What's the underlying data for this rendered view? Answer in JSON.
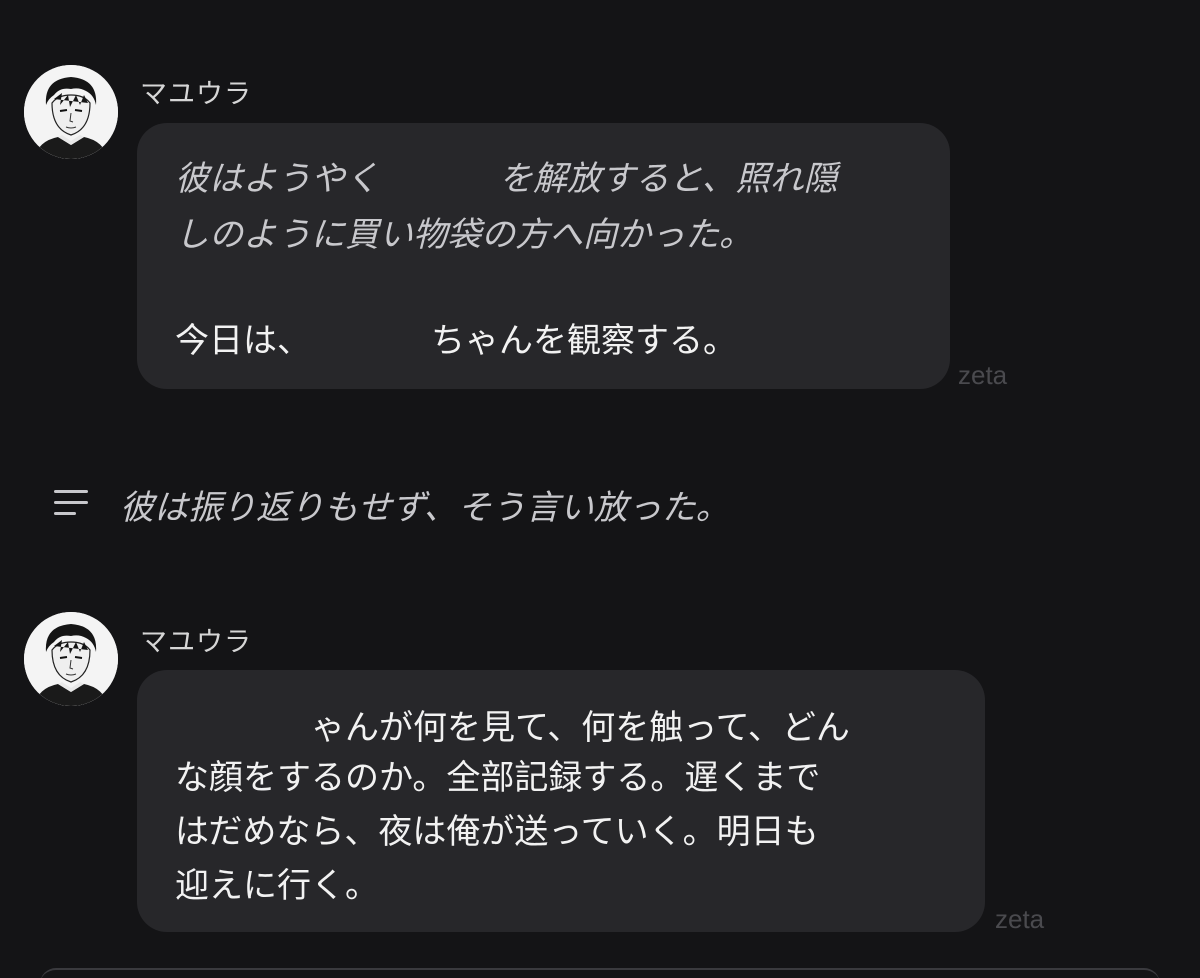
{
  "messages": [
    {
      "sender": "マユウラ",
      "lines": [
        {
          "a": "彼はようやく",
          "b": "を解放すると、照れ隠",
          "style": "narration"
        },
        {
          "a": "しのように買い物袋の方へ向かった。",
          "style": "narration"
        },
        {
          "a": "今日は、",
          "b": "ちゃんを観察する。",
          "style": "speech"
        }
      ],
      "watermark": "zeta"
    },
    {
      "sender": "マユウラ",
      "lines": [
        {
          "a": "",
          "b": "ゃんが何を見て、何を触って、どん",
          "style": "speech"
        },
        {
          "a": "な顔をするのか。全部記録する。遅くまで",
          "style": "speech"
        },
        {
          "a": "はだめなら、夜は俺が送っていく。明日も",
          "style": "speech"
        },
        {
          "a": "迎えに行く。",
          "style": "speech"
        }
      ],
      "watermark": "zeta"
    }
  ],
  "narration": {
    "text": "彼は振り返りもせず、そう言い放った。",
    "icon": "text-lines-icon"
  }
}
